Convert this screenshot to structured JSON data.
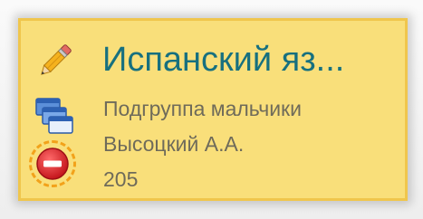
{
  "lesson_card": {
    "subject": "Испанский яз...",
    "subgroup": "Подгруппа мальчики",
    "teacher": "Высоцкий А.А.",
    "room": "205",
    "colors": {
      "card_background": "#f9df7a",
      "card_border": "#f0c64c",
      "title_color": "#17707f",
      "text_color": "#6f6b5a",
      "highlight_ring": "#f2a21a",
      "stop_icon": "#d9252b"
    },
    "icons": [
      "pencil-icon",
      "subgroups-icon",
      "stop-icon"
    ]
  }
}
